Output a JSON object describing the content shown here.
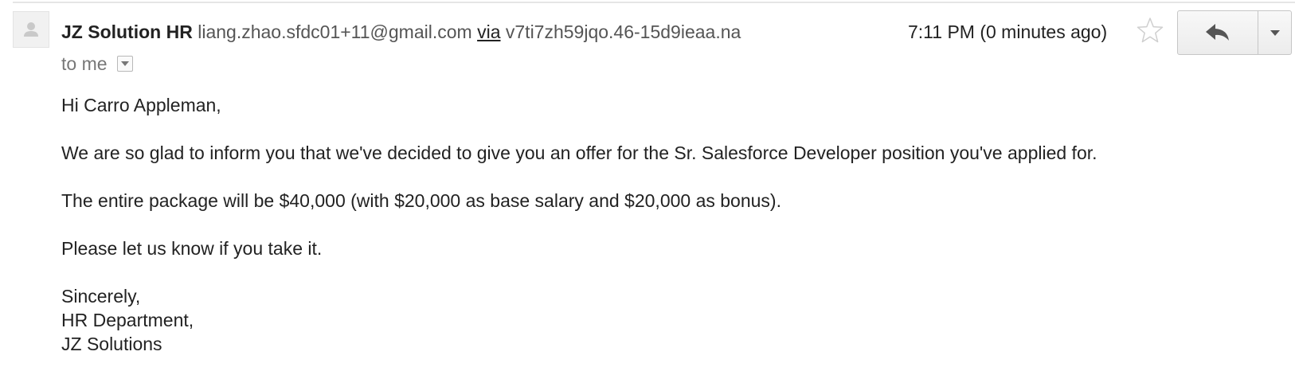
{
  "email": {
    "header": {
      "sender_name": "JZ Solution HR",
      "sender_email": "liang.zhao.sfdc01+11@gmail.com",
      "via_label": "via",
      "relay_domain": "v7ti7zh59jqo.46-15d9ieaa.na",
      "timestamp": "7:11 PM (0 minutes ago)",
      "recipient": "to me",
      "icons": {
        "avatar": "default-avatar-icon",
        "star": "star-outline-icon",
        "reply": "reply-icon",
        "more": "caret-down-icon",
        "details": "small-caret-down-icon"
      }
    },
    "body": {
      "greeting": "Hi Carro Appleman,",
      "paragraphs": [
        "We are so glad to inform you that we've decided to give you an offer for the Sr. Salesforce Developer position you've applied for.",
        "The entire package will be $40,000 (with $20,000 as base salary and $20,000 as bonus).",
        "Please let us know if you take it."
      ],
      "signature": [
        "Sincerely,",
        "HR Department,",
        "JZ Solutions"
      ]
    }
  }
}
